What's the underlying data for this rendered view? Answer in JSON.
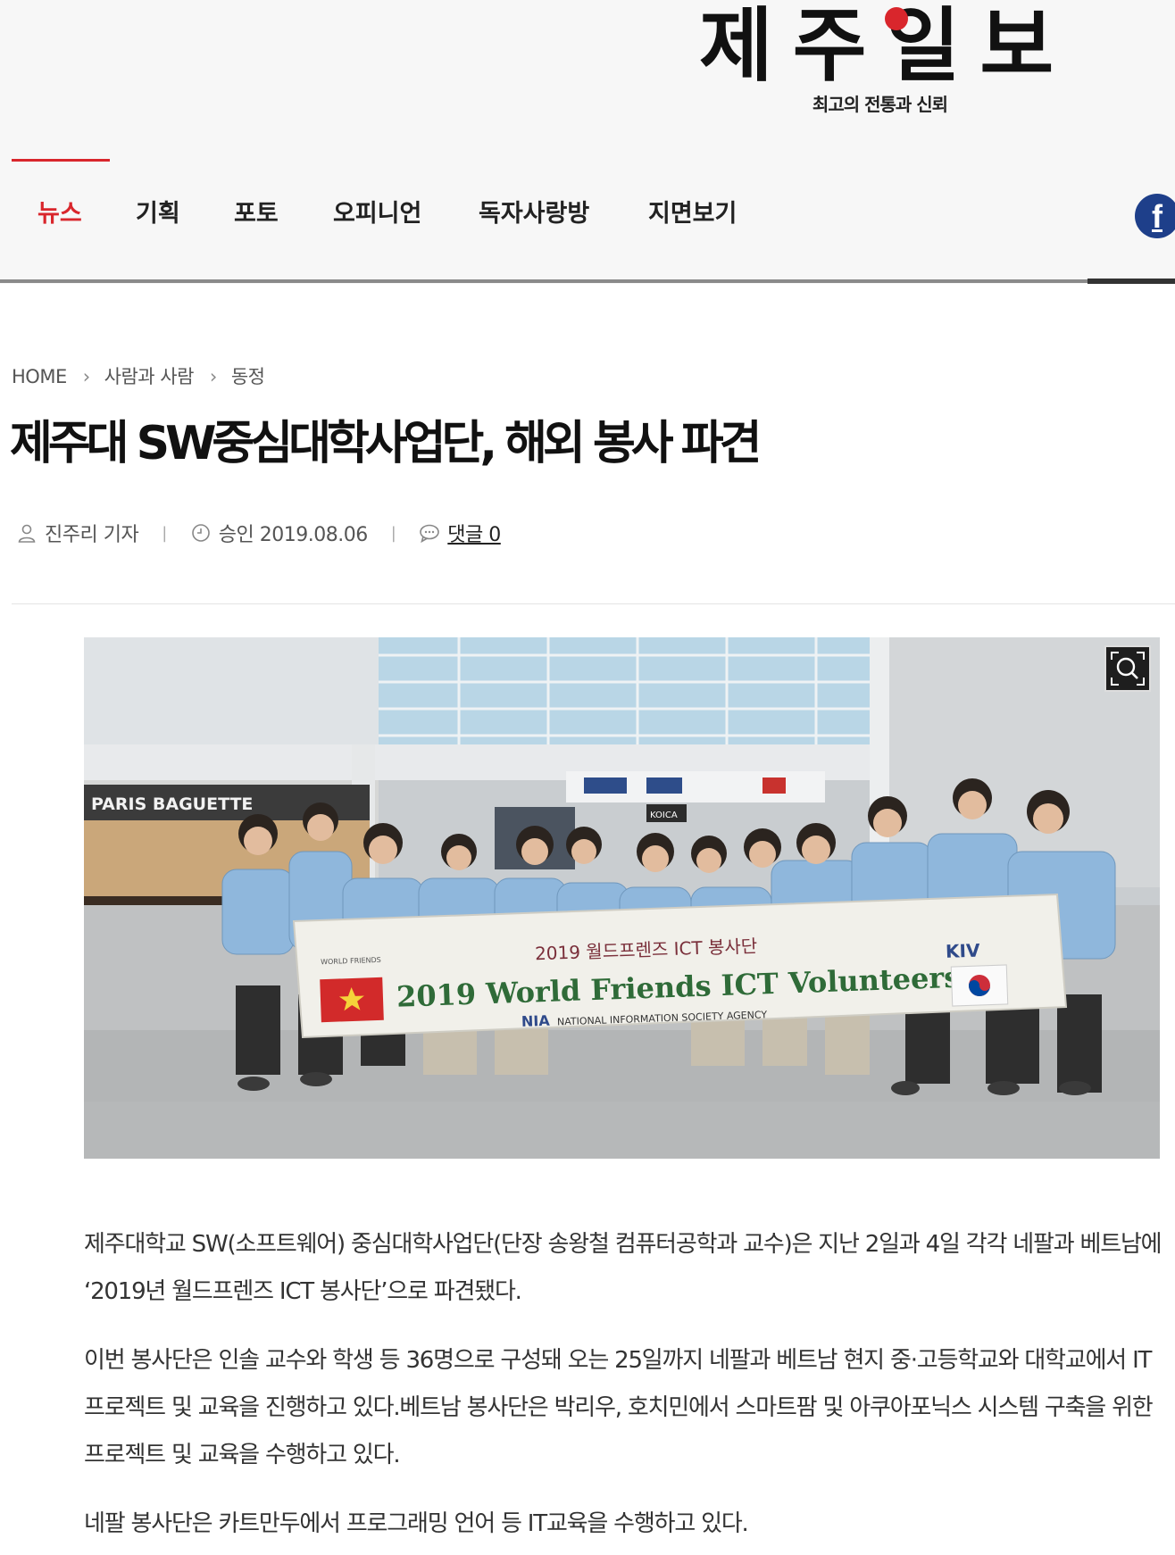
{
  "site": {
    "logo_text": "제주일보",
    "tagline": "최고의 전통과 신뢰"
  },
  "nav": {
    "items": [
      {
        "label": "뉴스",
        "active": true
      },
      {
        "label": "기획",
        "active": false
      },
      {
        "label": "포토",
        "active": false
      },
      {
        "label": "오피니언",
        "active": false
      },
      {
        "label": "독자사랑방",
        "active": false
      },
      {
        "label": "지면보기",
        "active": false
      }
    ],
    "social_icon": "facebook-icon",
    "social_glyph": "f"
  },
  "breadcrumb": {
    "home": "HOME",
    "section": "사람과 사람",
    "subsection": "동정",
    "separator": "›"
  },
  "article": {
    "title": "제주대 SW중심대학사업단, 해외 봉사 파견",
    "author": "진주리 기자",
    "approved": "승인 2019.08.06",
    "comments": "댓글 0",
    "separator": "|",
    "photo": {
      "signs": [
        "PARIS BAGUETTE",
        "KOICA"
      ],
      "banner_line1": "2019 월드프렌즈 ICT 봉사단",
      "banner_line2": "2019 World Friends ICT Volunteers",
      "banner_agency_abbr": "NIA",
      "banner_agency": "NATIONAL INFORMATION SOCIETY AGENCY",
      "banner_logo_left": "WORLD FRIENDS",
      "banner_logo_right": "KIV"
    },
    "paragraphs": [
      "제주대학교 SW(소프트웨어) 중심대학사업단(단장 송왕철 컴퓨터공학과 교수)은 지난 2일과 4일 각각 네팔과 베트남에 ‘2019년 월드프렌즈 ICT 봉사단’으로 파견됐다.",
      "이번 봉사단은 인솔 교수와 학생 등 36명으로 구성돼 오는 25일까지 네팔과 베트남 현지 중·고등학교와 대학교에서 IT 프로젝트 및 교육을 진행하고 있다.베트남 봉사단은 박리우, 호치민에서 스마트팜 및 아쿠아포닉스 시스템 구축을 위한 프로젝트 및 교육을 수행하고 있다.",
      "네팔 봉사단은 카트만두에서 프로그래밍 언어 등 IT교육을 수행하고 있다."
    ]
  },
  "colors": {
    "accent": "#d9262c",
    "facebook": "#1e3f8a",
    "header_bg": "#f7f7f7",
    "shirt": "#8fb7dc"
  }
}
